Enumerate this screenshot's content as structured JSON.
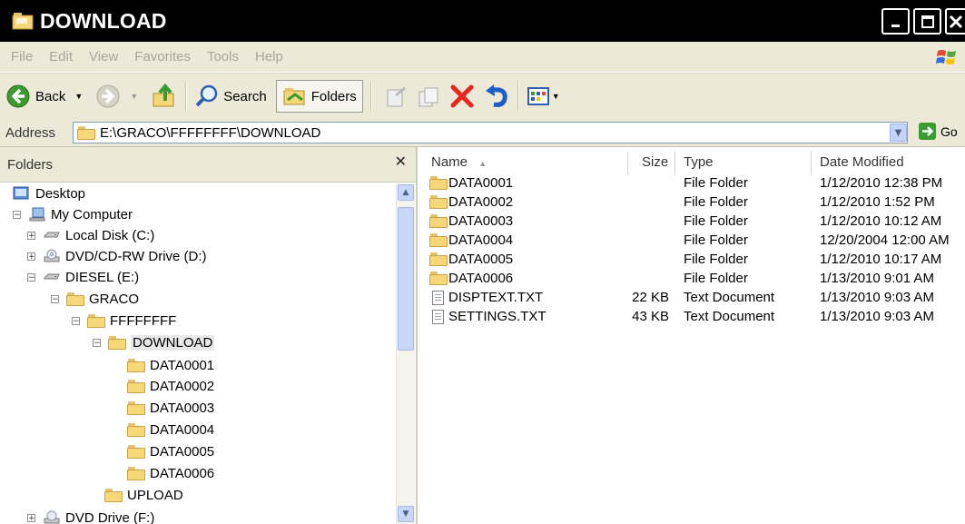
{
  "window": {
    "title": "DOWNLOAD"
  },
  "menu": [
    "File",
    "Edit",
    "View",
    "Favorites",
    "Tools",
    "Help"
  ],
  "toolbar": {
    "back": "Back",
    "search": "Search",
    "folders": "Folders"
  },
  "address": {
    "label": "Address",
    "path": "E:\\GRACO\\FFFFFFFF\\DOWNLOAD",
    "go": "Go"
  },
  "folders_pane": {
    "title": "Folders",
    "tree": [
      {
        "label": "Desktop",
        "icon": "desktop-icon"
      },
      {
        "label": "My Computer",
        "icon": "computer-icon"
      },
      {
        "label": "Local Disk (C:)",
        "icon": "drive-icon"
      },
      {
        "label": "DVD/CD-RW Drive (D:)",
        "icon": "cd-drive-icon"
      },
      {
        "label": "DIESEL (E:)",
        "icon": "drive-icon"
      },
      {
        "label": "GRACO",
        "icon": "folder-icon"
      },
      {
        "label": "FFFFFFFF",
        "icon": "folder-icon"
      },
      {
        "label": "DOWNLOAD",
        "icon": "folder-icon"
      },
      {
        "label": "DATA0001",
        "icon": "folder-icon"
      },
      {
        "label": "DATA0002",
        "icon": "folder-icon"
      },
      {
        "label": "DATA0003",
        "icon": "folder-icon"
      },
      {
        "label": "DATA0004",
        "icon": "folder-icon"
      },
      {
        "label": "DATA0005",
        "icon": "folder-icon"
      },
      {
        "label": "DATA0006",
        "icon": "folder-icon"
      },
      {
        "label": "UPLOAD",
        "icon": "folder-icon"
      },
      {
        "label": "DVD Drive (F:)",
        "icon": "cd-drive-icon"
      }
    ]
  },
  "file_list": {
    "columns": [
      "Name",
      "Size",
      "Type",
      "Date Modified"
    ],
    "rows": [
      {
        "name": "DATA0001",
        "size": "",
        "type": "File Folder",
        "date": "1/12/2010 12:38 PM",
        "icon": "folder-icon"
      },
      {
        "name": "DATA0002",
        "size": "",
        "type": "File Folder",
        "date": "1/12/2010 1:52 PM",
        "icon": "folder-icon"
      },
      {
        "name": "DATA0003",
        "size": "",
        "type": "File Folder",
        "date": "1/12/2010 10:12 AM",
        "icon": "folder-icon"
      },
      {
        "name": "DATA0004",
        "size": "",
        "type": "File Folder",
        "date": "12/20/2004 12:00 AM",
        "icon": "folder-icon"
      },
      {
        "name": "DATA0005",
        "size": "",
        "type": "File Folder",
        "date": "1/12/2010 10:17 AM",
        "icon": "folder-icon"
      },
      {
        "name": "DATA0006",
        "size": "",
        "type": "File Folder",
        "date": "1/13/2010 9:01 AM",
        "icon": "folder-icon"
      },
      {
        "name": "DISPTEXT.TXT",
        "size": "22 KB",
        "type": "Text Document",
        "date": "1/13/2010 9:03 AM",
        "icon": "text-file-icon"
      },
      {
        "name": "SETTINGS.TXT",
        "size": "43 KB",
        "type": "Text Document",
        "date": "1/13/2010 9:03 AM",
        "icon": "text-file-icon"
      }
    ]
  },
  "colors": {
    "title_bar": "#000000",
    "chrome": "#ece9d8",
    "folder": "#f6d778",
    "delete_x": "#e8261c",
    "go_green": "#3c9a32"
  }
}
